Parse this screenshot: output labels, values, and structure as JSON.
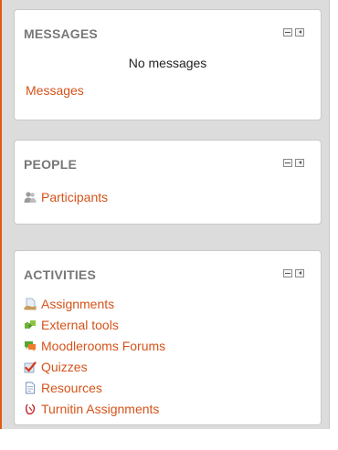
{
  "messages_block": {
    "title": "MESSAGES",
    "empty_text": "No messages",
    "link_label": "Messages"
  },
  "people_block": {
    "title": "PEOPLE",
    "items": [
      {
        "label": "Participants",
        "icon": "participants-icon"
      }
    ]
  },
  "activities_block": {
    "title": "ACTIVITIES",
    "items": [
      {
        "label": "Assignments",
        "icon": "assignment-icon"
      },
      {
        "label": "External tools",
        "icon": "puzzle-icon"
      },
      {
        "label": "Moodlerooms Forums",
        "icon": "forum-icon"
      },
      {
        "label": "Quizzes",
        "icon": "quiz-icon"
      },
      {
        "label": "Resources",
        "icon": "resource-icon"
      },
      {
        "label": "Turnitin Assignments",
        "icon": "turnitin-icon"
      }
    ]
  },
  "colors": {
    "link": "#d4531a",
    "header": "#777777",
    "accent_border": "#e25a12"
  }
}
